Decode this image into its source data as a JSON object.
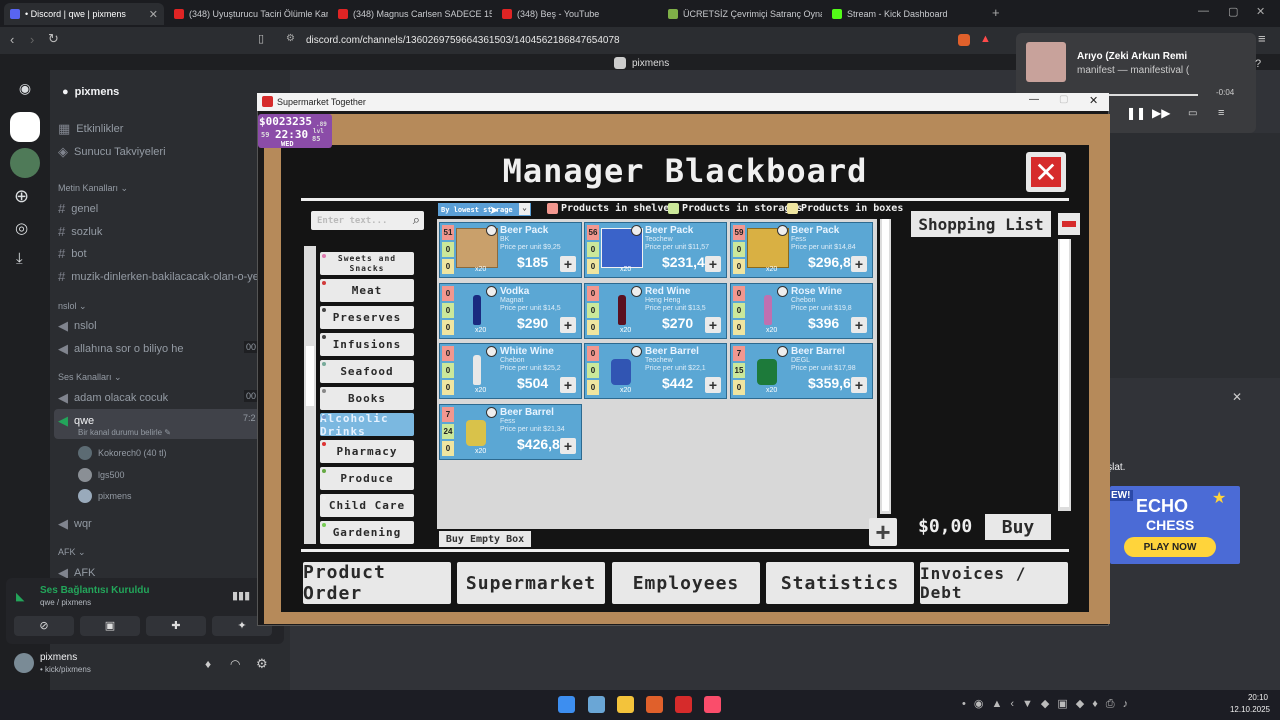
{
  "browser": {
    "tabs": [
      {
        "title": "• Discord | qwe | pixmens",
        "color": "#5865f2"
      },
      {
        "title": "(348) Uyuşturucu Taciri Ölümle Karşı",
        "color": "#e02424"
      },
      {
        "title": "(348) Magnus Carlsen SADECE 15 SA",
        "color": "#e02424"
      },
      {
        "title": "(348) Beş - YouTube",
        "color": "#e02424"
      },
      {
        "title": "ÜCRETSİZ Çevrimiçi Satranç Oynayın",
        "color": "#7fb048"
      },
      {
        "title": "Stream - Kick Dashboard",
        "color": "#53fc18"
      }
    ],
    "url": "discord.com/channels/1360269759664361503/1404562186847654078"
  },
  "discord": {
    "top_user": "pixmens",
    "server_name": "pixmens",
    "items": [
      "Etkinlikler",
      "Sunucu Takviyeleri"
    ],
    "cat_text": "Metin Kanalları",
    "text_channels": [
      "genel",
      "sozluk",
      "bot",
      "muzik-dinlerken-bakilacacak-olan-o-ye"
    ],
    "cat_nslol": "nslol",
    "nslol_channels": [
      "nslol",
      "allahına sor o biliyo he"
    ],
    "cat_voice": "Ses Kanalları",
    "voice_channels": [
      "adam olacak cocuk",
      "qwe"
    ],
    "qwe_status": "Bir kanal durumu belirle",
    "voice_users": [
      "Kokorech0 (40 tl)",
      "lgs500",
      "pixmens"
    ],
    "other_channel": "wqr",
    "cat_afk": "AFK",
    "afk_channel": "AFK",
    "voice_connected": "Ses Bağlantısı Kuruldu",
    "voice_connected_sub": "qwe / pixmens",
    "user_name": "pixmens",
    "user_status": "• kick/pixmens",
    "counts": [
      "00",
      "00",
      "7:2"
    ]
  },
  "media": {
    "title": "Arıyo (Zeki Arkun Remi",
    "artist": "manifest — manifestival (",
    "time": "-0:04"
  },
  "side_right": {
    "text": "başlat.",
    "ad_title": "ECHO",
    "ad_sub": "CHESS",
    "ad_cta": "PLAY NOW",
    "ad_ribbon": "EW!"
  },
  "game": {
    "window_title": "Supermarket Together",
    "money": "$0023235",
    "time": "22:30",
    "day_small": "59",
    "lvl": "lvl",
    "lvl_num": "85",
    "money_small": ".89",
    "weekday": "WED",
    "board_title": "Manager Blackboard",
    "search_placeholder": "Enter text...",
    "sort_label": "By lowest storage",
    "legend": [
      "Products in shelves",
      "Products in storages",
      "Products in boxes"
    ],
    "categories": [
      "Sweets and Snacks",
      "Meat",
      "Preserves",
      "Infusions",
      "Seafood",
      "Books",
      "Alcoholic Drinks",
      "Pharmacy",
      "Produce",
      "Child Care",
      "Gardening"
    ],
    "products": [
      {
        "name": "Beer Pack",
        "brand": "BK",
        "ppu": "Price per unit $9,25",
        "price": "$185",
        "shelves": "51",
        "storage": "0",
        "boxes": "0",
        "qty": "x20",
        "img": "box"
      },
      {
        "name": "Beer Pack",
        "brand": "Teochew",
        "ppu": "Price per unit $11,57",
        "price": "$231,4",
        "shelves": "56",
        "storage": "0",
        "boxes": "0",
        "qty": "x20",
        "img": "boxblue"
      },
      {
        "name": "Beer Pack",
        "brand": "Fess",
        "ppu": "Price per unit $14,84",
        "price": "$296,8",
        "shelves": "59",
        "storage": "0",
        "boxes": "0",
        "qty": "x20",
        "img": "boxyellow"
      },
      {
        "name": "Vodka",
        "brand": "Magnat",
        "ppu": "Price per unit $14,5",
        "price": "$290",
        "shelves": "0",
        "storage": "0",
        "boxes": "0",
        "qty": "x20",
        "img": "bottle"
      },
      {
        "name": "Red Wine",
        "brand": "Heng Heng",
        "ppu": "Price per unit $13,5",
        "price": "$270",
        "shelves": "0",
        "storage": "0",
        "boxes": "0",
        "qty": "x20",
        "img": "wine"
      },
      {
        "name": "Rose Wine",
        "brand": "Chebon",
        "ppu": "Price per unit $19,8",
        "price": "$396",
        "shelves": "0",
        "storage": "0",
        "boxes": "0",
        "qty": "x20",
        "img": "rose"
      },
      {
        "name": "White Wine",
        "brand": "Chebon",
        "ppu": "Price per unit $25,2",
        "price": "$504",
        "shelves": "0",
        "storage": "0",
        "boxes": "0",
        "qty": "x20",
        "img": "white"
      },
      {
        "name": "Beer Barrel",
        "brand": "Teochew",
        "ppu": "Price per unit $22,1",
        "price": "$442",
        "shelves": "0",
        "storage": "0",
        "boxes": "0",
        "qty": "x20",
        "img": "barrelblue"
      },
      {
        "name": "Beer Barrel",
        "brand": "DEGL",
        "ppu": "Price per unit $17,98",
        "price": "$359,6",
        "shelves": "7",
        "storage": "15",
        "boxes": "0",
        "qty": "x20",
        "img": "barrelgreen"
      },
      {
        "name": "Beer Barrel",
        "brand": "Fess",
        "ppu": "Price per unit $21,34",
        "price": "$426,8",
        "shelves": "7",
        "storage": "24",
        "boxes": "0",
        "qty": "x20",
        "img": "barrelyellow"
      }
    ],
    "buy_empty_box": "Buy Empty Box",
    "shopping_list": "Shopping List",
    "total": "$0,00",
    "buy": "Buy",
    "bottom_tabs": [
      "Product Order",
      "Supermarket",
      "Employees",
      "Statistics",
      "Invoices / Debt"
    ]
  },
  "taskbar": {
    "time": "20:10",
    "date": "12.10.2025"
  }
}
